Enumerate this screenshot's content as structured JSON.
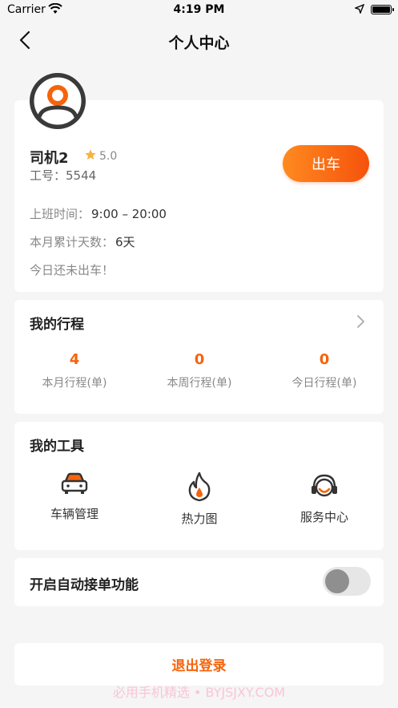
{
  "status_bar": {
    "carrier": "Carrier",
    "time": "4:19 PM"
  },
  "nav": {
    "title": "个人中心"
  },
  "profile": {
    "name": "司机2",
    "rating": "5.0",
    "employee_no": "工号：5544",
    "depart_label": "出车",
    "shift_label": "上班时间：",
    "shift_value": "9:00 – 20:00",
    "days_label": "本月累计天数：",
    "days_value": "6天",
    "today_status": "今日还未出车！"
  },
  "trips": {
    "title": "我的行程",
    "stats": [
      {
        "value": "4",
        "label": "本月行程(单)"
      },
      {
        "value": "0",
        "label": "本周行程(单)"
      },
      {
        "value": "0",
        "label": "今日行程(单)"
      }
    ]
  },
  "tools": {
    "title": "我的工具",
    "items": [
      {
        "label": "车辆管理",
        "icon": "car-icon"
      },
      {
        "label": "热力图",
        "icon": "flame-icon"
      },
      {
        "label": "服务中心",
        "icon": "headset-icon"
      }
    ]
  },
  "auto_accept": {
    "label": "开启自动接单功能",
    "enabled": false
  },
  "logout": {
    "label": "退出登录"
  },
  "watermark": "必用手机精选 • BYJSJXY.COM",
  "colors": {
    "accent": "#f5640c",
    "background": "#f5f5f5"
  }
}
